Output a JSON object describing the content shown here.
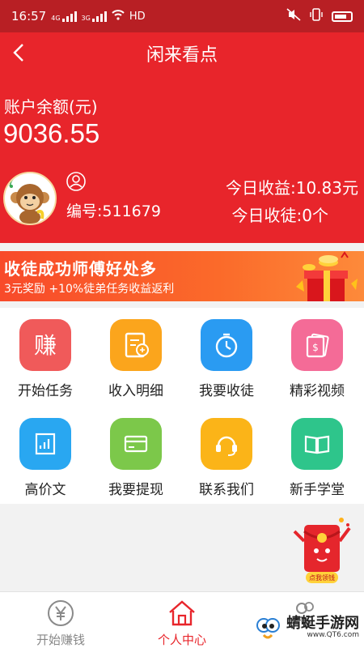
{
  "status": {
    "time": "16:57",
    "net1": "4G",
    "net2": "3G",
    "hd": "HD"
  },
  "header": {
    "title": "闲来看点",
    "balance_label": "账户余额(元)",
    "balance_value": "9036.55",
    "user_id": "编号:511679",
    "today_income": "今日收益:10.83元",
    "today_recruit": "今日收徒:0个"
  },
  "banner": {
    "title": "收徒成功师傅好处多",
    "subtitle": "3元奖励 +10%徒弟任务收益返利"
  },
  "menu": [
    {
      "label": "开始任务",
      "icon": "earn-icon",
      "color": "#f05a5a"
    },
    {
      "label": "收入明细",
      "icon": "ledger-icon",
      "color": "#fba51c"
    },
    {
      "label": "我要收徒",
      "icon": "stopwatch-icon",
      "color": "#2a9bf2"
    },
    {
      "label": "精彩视频",
      "icon": "video-icon",
      "color": "#f46b97"
    },
    {
      "label": "高价文",
      "icon": "article-chart-icon",
      "color": "#29a7f1"
    },
    {
      "label": "我要提现",
      "icon": "card-icon",
      "color": "#7cc84a"
    },
    {
      "label": "联系我们",
      "icon": "headset-icon",
      "color": "#fbb418"
    },
    {
      "label": "新手学堂",
      "icon": "book-icon",
      "color": "#2ec58b"
    }
  ],
  "float_badge": {
    "label": "点我领钱"
  },
  "tabs": [
    {
      "label": "开始赚钱",
      "icon": "yen-coin-icon",
      "active": false
    },
    {
      "label": "个人中心",
      "icon": "home-icon",
      "active": true
    },
    {
      "label": "",
      "icon": "friends-icon",
      "active": false
    }
  ],
  "watermark": {
    "name": "蜻蜓手游网",
    "url": "www.QT6.com"
  },
  "colors": {
    "header_red": "#e8252b",
    "status_red": "#b81f24",
    "active_tab": "#e8252b"
  }
}
